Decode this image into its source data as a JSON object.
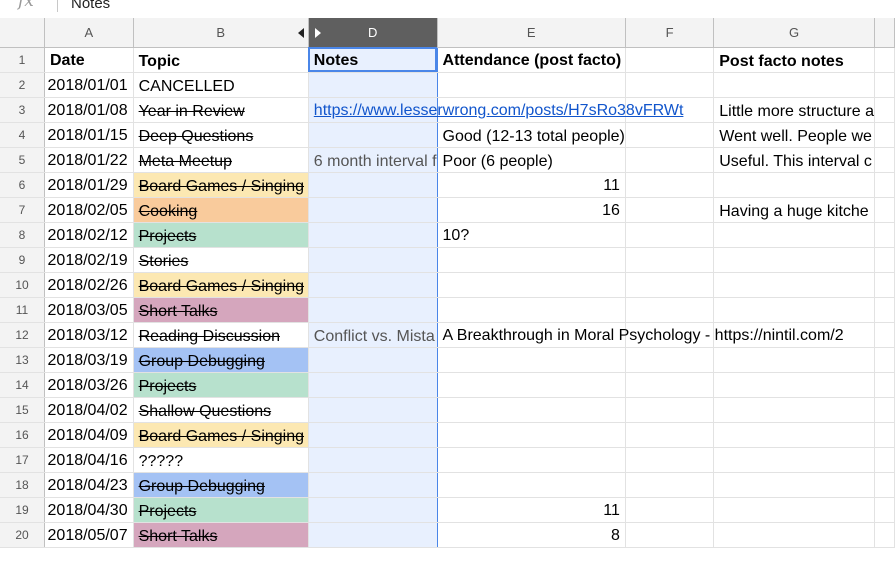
{
  "formula_bar": {
    "fx": "fx",
    "content": "Notes"
  },
  "columns": [
    "A",
    "B",
    "D",
    "E",
    "F",
    "G",
    ""
  ],
  "colors": {
    "yellow": "#fce8b2",
    "orange": "#f9cb9c",
    "green": "#b7e1cd",
    "pink": "#d5a6bd",
    "blue": "#a4c2f4",
    "selection_blue": "#e8f0fe"
  },
  "rows": [
    {
      "num": "1",
      "a": "Date",
      "b": "Topic",
      "d": "Notes",
      "e": "Attendance (post facto)",
      "f": "",
      "g": "Post facto notes"
    },
    {
      "num": "2",
      "a": "2018/01/01",
      "b": "CANCELLED",
      "d": "",
      "e": "",
      "f": "",
      "g": ""
    },
    {
      "num": "3",
      "a": "2018/01/08",
      "b": "Year in Review",
      "d": "https://www.lesserwrong.com/posts/H7sRo38vFRWt",
      "e": "",
      "f": "",
      "g": "Little more structure a"
    },
    {
      "num": "4",
      "a": "2018/01/15",
      "b": "Deep Questions",
      "d": "",
      "e": "Good (12-13 total people)",
      "f": "",
      "g": "Went well. People we"
    },
    {
      "num": "5",
      "a": "2018/01/22",
      "b": "Meta Meetup",
      "d": "6 month interval f",
      "e": "Poor (6 people)",
      "f": "",
      "g": "Useful. This interval c"
    },
    {
      "num": "6",
      "a": "2018/01/29",
      "b": "Board Games / Singing",
      "d": "",
      "e": "11",
      "f": "",
      "g": ""
    },
    {
      "num": "7",
      "a": "2018/02/05",
      "b": "Cooking",
      "d": "",
      "e": "16",
      "f": "",
      "g": "Having a huge kitche"
    },
    {
      "num": "8",
      "a": "2018/02/12",
      "b": "Projects",
      "d": "",
      "e": "10?",
      "f": "",
      "g": ""
    },
    {
      "num": "9",
      "a": "2018/02/19",
      "b": "Stories",
      "d": "",
      "e": "",
      "f": "",
      "g": ""
    },
    {
      "num": "10",
      "a": "2018/02/26",
      "b": "Board Games / Singing",
      "d": "",
      "e": "",
      "f": "",
      "g": ""
    },
    {
      "num": "11",
      "a": "2018/03/05",
      "b": "Short Talks",
      "d": "",
      "e": "",
      "f": "",
      "g": ""
    },
    {
      "num": "12",
      "a": "2018/03/12",
      "b": "Reading Discussion",
      "d": "Conflict vs. Mista",
      "e": "A Breakthrough in Moral Psychology - https://nintil.com/2",
      "f": "",
      "g": ""
    },
    {
      "num": "13",
      "a": "2018/03/19",
      "b": "Group Debugging",
      "d": "",
      "e": "",
      "f": "",
      "g": ""
    },
    {
      "num": "14",
      "a": "2018/03/26",
      "b": "Projects",
      "d": "",
      "e": "",
      "f": "",
      "g": ""
    },
    {
      "num": "15",
      "a": "2018/04/02",
      "b": "Shallow Questions",
      "d": "",
      "e": "",
      "f": "",
      "g": ""
    },
    {
      "num": "16",
      "a": "2018/04/09",
      "b": "Board Games / Singing",
      "d": "",
      "e": "",
      "f": "",
      "g": ""
    },
    {
      "num": "17",
      "a": "2018/04/16",
      "b": "?????",
      "d": "",
      "e": "",
      "f": "",
      "g": ""
    },
    {
      "num": "18",
      "a": "2018/04/23",
      "b": "Group Debugging",
      "d": "",
      "e": "",
      "f": "",
      "g": ""
    },
    {
      "num": "19",
      "a": "2018/04/30",
      "b": "Projects",
      "d": "",
      "e": "11",
      "f": "",
      "g": ""
    },
    {
      "num": "20",
      "a": "2018/05/07",
      "b": "Short Talks",
      "d": "",
      "e": "8",
      "f": "",
      "g": ""
    }
  ]
}
